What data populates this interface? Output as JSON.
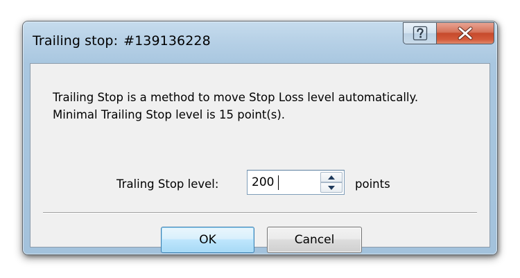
{
  "window": {
    "title": "Trailing stop:",
    "ticket": "#139136228",
    "help_icon": "question-mark-icon",
    "close_icon": "close-x-icon",
    "close_color": "#c64a2c"
  },
  "description": {
    "line1": "Trailing Stop is a method to move Stop Loss level automatically.",
    "line2": "Minimal Trailing Stop level is 15 point(s)."
  },
  "level": {
    "label": "Traling Stop level:",
    "value": "200",
    "units": "points"
  },
  "buttons": {
    "ok_label": "OK",
    "cancel_label": "Cancel",
    "default_border_color": "#3c7fb1"
  }
}
